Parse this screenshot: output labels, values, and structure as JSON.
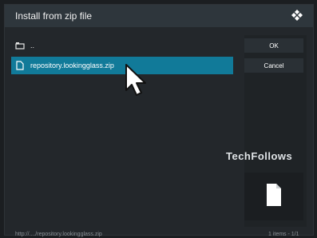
{
  "window": {
    "title": "Install from zip file",
    "logo_icon": "kodi-logo-icon"
  },
  "list": {
    "items": [
      {
        "label": "..",
        "icon": "parent-folder-icon",
        "selected": false
      },
      {
        "label": "repository.lookingglass.zip",
        "icon": "zip-file-icon",
        "selected": true
      }
    ]
  },
  "buttons": {
    "ok_label": "OK",
    "cancel_label": "Cancel"
  },
  "preview": {
    "icon": "file-icon"
  },
  "watermark": {
    "text": "TechFollows"
  },
  "footer": {
    "path": "http://..../repository.lookingglass.zip",
    "count": "1 items - 1/1"
  },
  "colors": {
    "accent": "#117a99",
    "background": "#23272b"
  }
}
